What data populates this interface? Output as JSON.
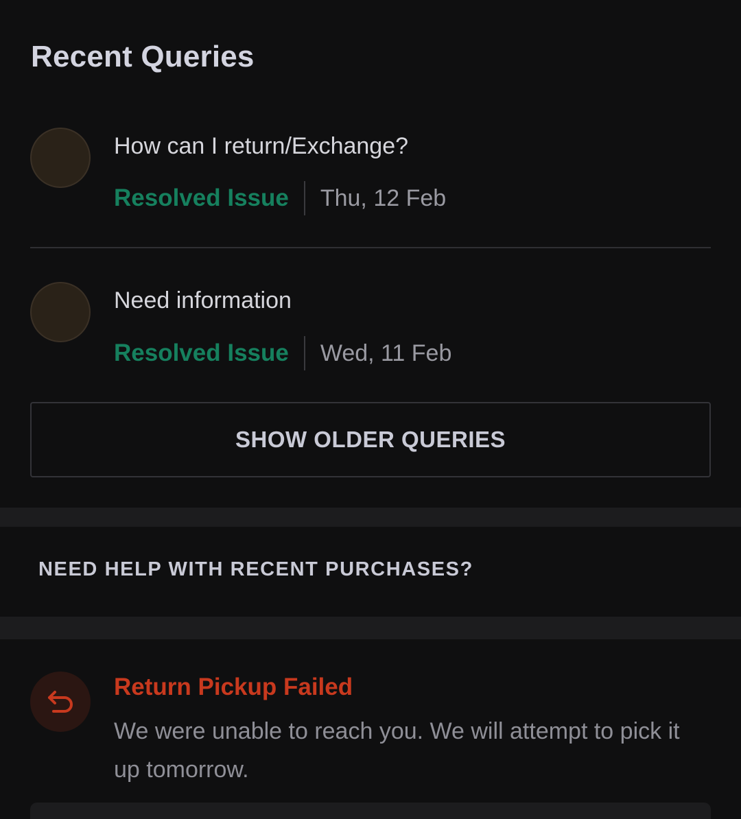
{
  "recent_queries": {
    "title": "Recent Queries",
    "items": [
      {
        "question": "How can I return/Exchange?",
        "status": "Resolved Issue",
        "date": "Thu, 12 Feb"
      },
      {
        "question": "Need information",
        "status": "Resolved Issue",
        "date": "Wed, 11 Feb"
      }
    ],
    "show_older_label": "SHOW OLDER QUERIES"
  },
  "help": {
    "heading": "NEED HELP WITH RECENT PURCHASES?"
  },
  "alert": {
    "icon": "return-arrow-icon",
    "title": "Return Pickup Failed",
    "message": "We were unable to reach you. We will attempt to pick it up tomorrow."
  },
  "colors": {
    "background": "#0f0f10",
    "resolved": "#16805e",
    "failed": "#c8391e",
    "band": "#1c1c1e"
  }
}
